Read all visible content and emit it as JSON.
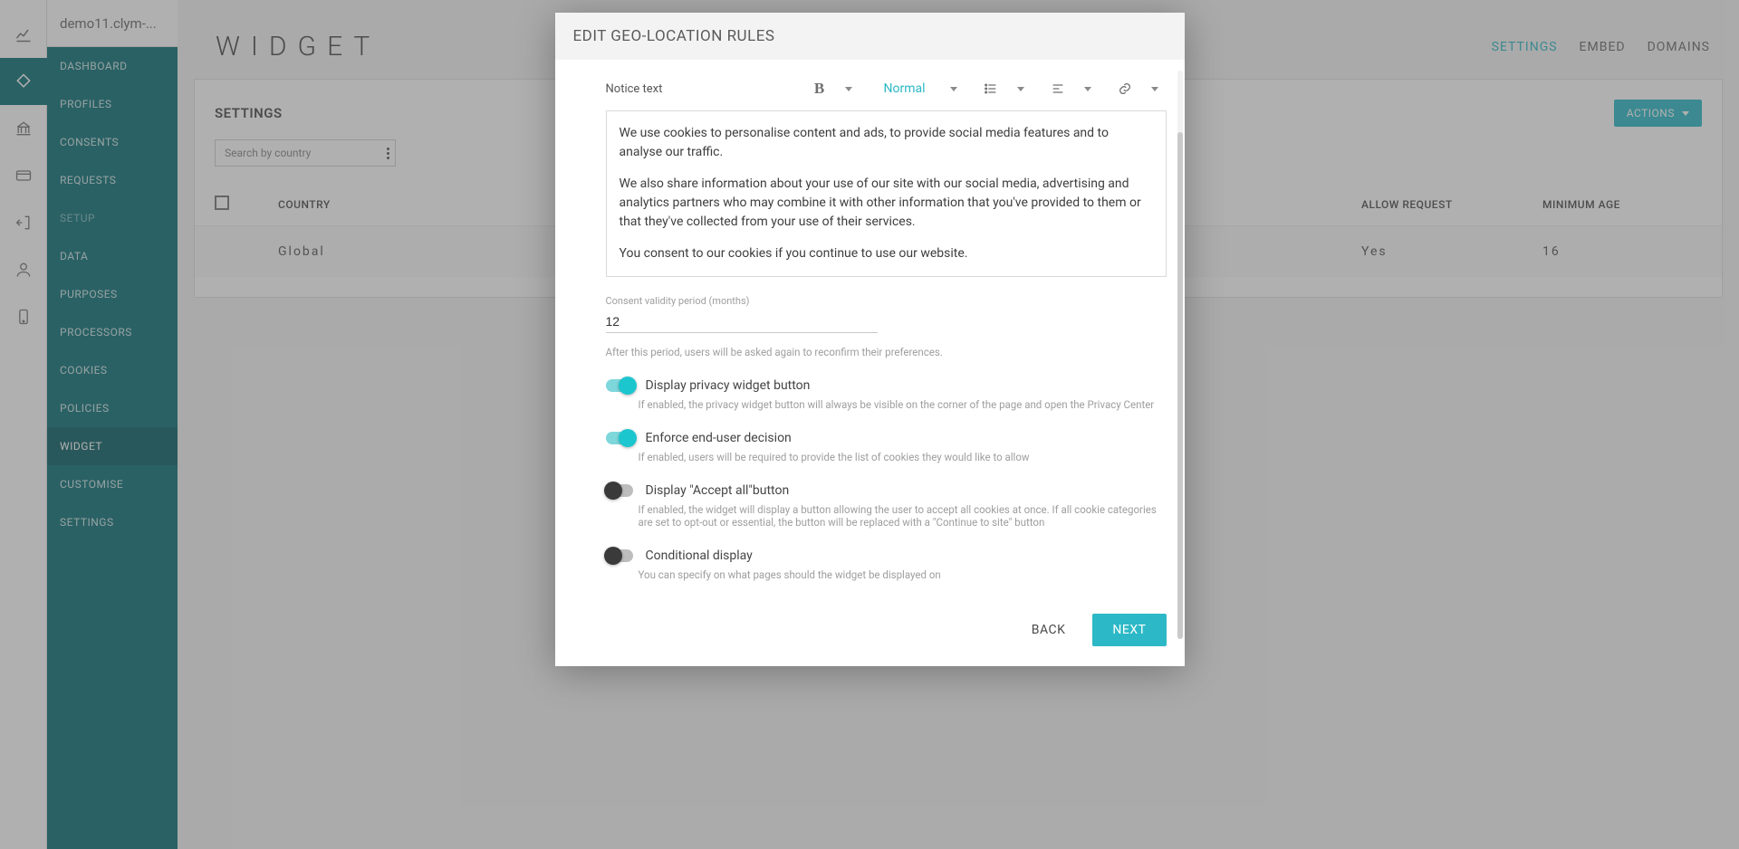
{
  "app": {
    "title": "demo11.clym-..."
  },
  "rail": {
    "items": [
      "chart",
      "diamond",
      "bank",
      "card",
      "door",
      "user",
      "device"
    ],
    "activeIndex": 1
  },
  "sidebar": {
    "items": [
      {
        "label": "DASHBOARD",
        "dim": false
      },
      {
        "label": "PROFILES",
        "dim": false
      },
      {
        "label": "CONSENTS",
        "dim": false
      },
      {
        "label": "REQUESTS",
        "dim": false
      },
      {
        "label": "SETUP",
        "dim": true
      },
      {
        "label": "DATA",
        "dim": false
      },
      {
        "label": "PURPOSES",
        "dim": false
      },
      {
        "label": "PROCESSORS",
        "dim": false
      },
      {
        "label": "COOKIES",
        "dim": false
      },
      {
        "label": "POLICIES",
        "dim": false
      },
      {
        "label": "WIDGET",
        "dim": false,
        "active": true
      },
      {
        "label": "CUSTOMISE",
        "dim": false
      },
      {
        "label": "SETTINGS",
        "dim": false
      }
    ]
  },
  "page": {
    "title": "WIDGET",
    "tabs": [
      {
        "label": "SETTINGS",
        "active": true
      },
      {
        "label": "EMBED"
      },
      {
        "label": "DOMAINS"
      }
    ]
  },
  "panel": {
    "subtitle": "SETTINGS",
    "search_placeholder": "Search by country",
    "actions_label": "ACTIONS",
    "columns": {
      "country": "COUNTRY",
      "allow": "ALLOW REQUEST",
      "age": "MINIMUM AGE"
    },
    "rows": [
      {
        "country": "Global",
        "allow": "Yes",
        "age": "16"
      }
    ]
  },
  "modal": {
    "title": "EDIT GEO-LOCATION RULES",
    "notice_label": "Notice text",
    "format_select": "Normal",
    "notice_paragraphs": [
      "We use cookies to personalise content and ads, to provide social media features and to analyse our traffic.",
      "We also share information about your use of our site with our social media, advertising and analytics partners who may combine it with other information that you've provided to them or that they've collected from your use of their services.",
      "You consent to our cookies if you continue to use our website."
    ],
    "validity": {
      "label": "Consent validity period (months)",
      "value": "12",
      "help": "After this period, users will be asked again to reconfirm their preferences."
    },
    "switches": [
      {
        "key": "privacy",
        "title": "Display privacy widget button",
        "desc": "If enabled, the privacy widget button will always be visible on the corner of the page and open the Privacy Center",
        "on": true
      },
      {
        "key": "enforce",
        "title": "Enforce end-user decision",
        "desc": "If enabled, users will be required to provide the list of cookies they would like to allow",
        "on": true
      },
      {
        "key": "acceptall",
        "title": "Display \"Accept all\"button",
        "desc": "If enabled, the widget will display a button allowing the user to accept all cookies at once. If all cookie categories are set to opt-out or essential, the button will be replaced with a \"Continue to site\" button",
        "on": false
      },
      {
        "key": "conditional",
        "title": "Conditional display",
        "desc": "You can specify on what pages should the widget be displayed on",
        "on": false
      }
    ],
    "buttons": {
      "back": "BACK",
      "next": "NEXT"
    }
  }
}
